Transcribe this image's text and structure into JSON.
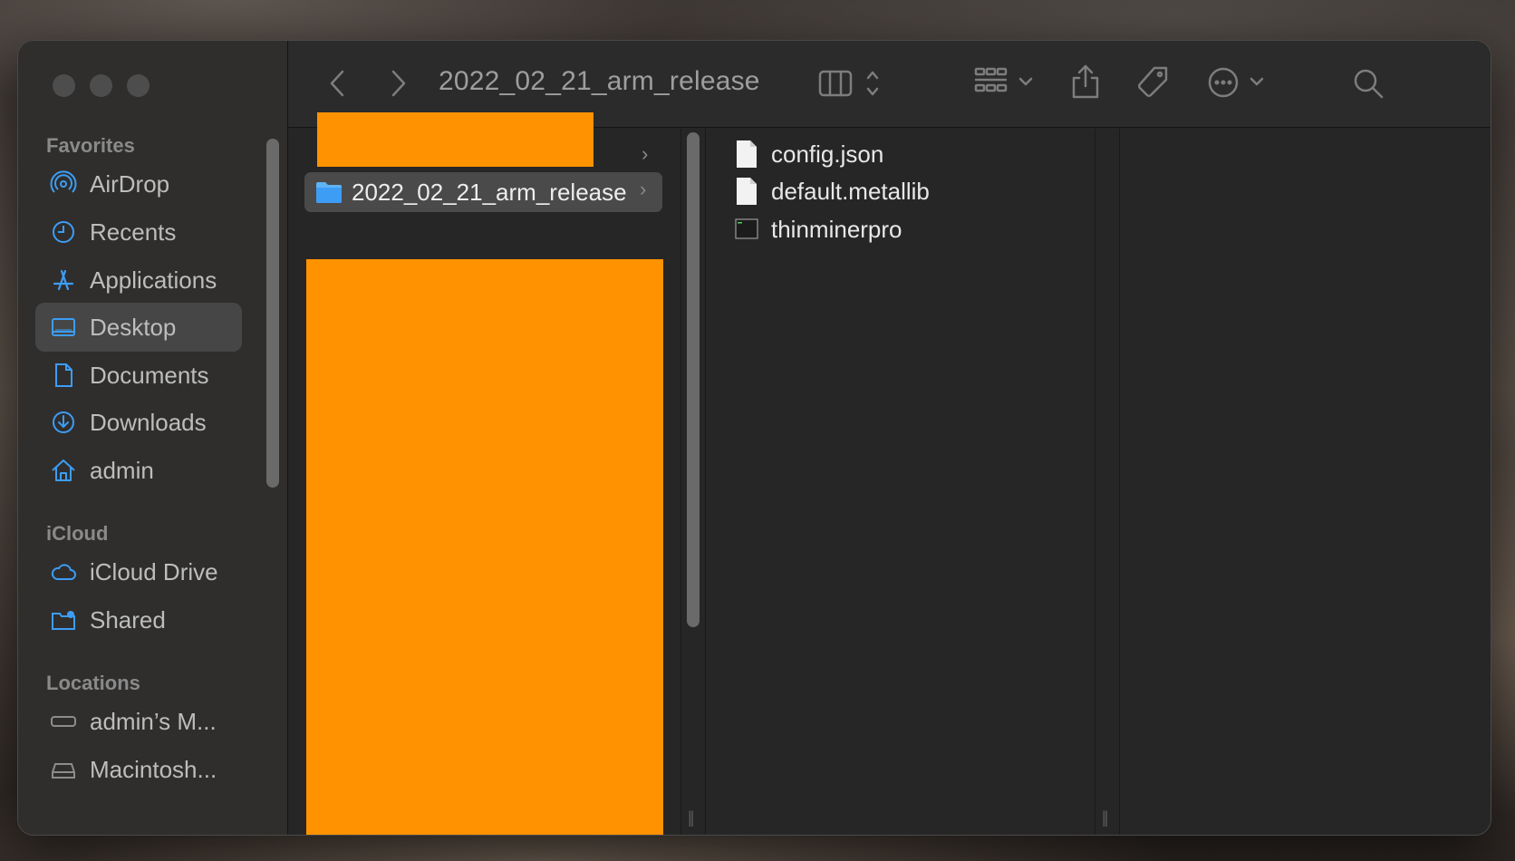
{
  "window": {
    "title": "2022_02_21_arm_release"
  },
  "sidebar": {
    "sections": [
      {
        "label": "Favorites",
        "items": [
          {
            "label": "AirDrop",
            "icon": "airdrop-icon"
          },
          {
            "label": "Recents",
            "icon": "clock-icon"
          },
          {
            "label": "Applications",
            "icon": "applications-icon"
          },
          {
            "label": "Desktop",
            "icon": "desktop-icon",
            "selected": true
          },
          {
            "label": "Documents",
            "icon": "document-icon"
          },
          {
            "label": "Downloads",
            "icon": "download-icon"
          },
          {
            "label": "admin",
            "icon": "home-icon"
          }
        ]
      },
      {
        "label": "iCloud",
        "items": [
          {
            "label": "iCloud Drive",
            "icon": "cloud-icon"
          },
          {
            "label": "Shared",
            "icon": "shared-folder-icon"
          }
        ]
      },
      {
        "label": "Locations",
        "items": [
          {
            "label": "admin’s M...",
            "icon": "computer-icon"
          },
          {
            "label": "Macintosh...",
            "icon": "disk-icon"
          }
        ]
      }
    ]
  },
  "toolbar": {
    "back": "chevron-left-icon",
    "forward": "chevron-right-icon",
    "view": "columns-view-icon",
    "group": "grid-group-icon",
    "share": "share-icon",
    "tag": "tag-icon",
    "more": "ellipsis-circle-icon",
    "search": "search-icon"
  },
  "columns": {
    "col1_selected": "2022_02_21_arm_release",
    "col2_files": [
      {
        "name": "config.json",
        "icon": "file-icon"
      },
      {
        "name": "default.metallib",
        "icon": "file-icon"
      },
      {
        "name": "thinminerpro",
        "icon": "terminal-exec-icon"
      }
    ]
  },
  "colors": {
    "accent": "#3d9df5",
    "redaction": "#ff9200",
    "selection": "#464646"
  }
}
